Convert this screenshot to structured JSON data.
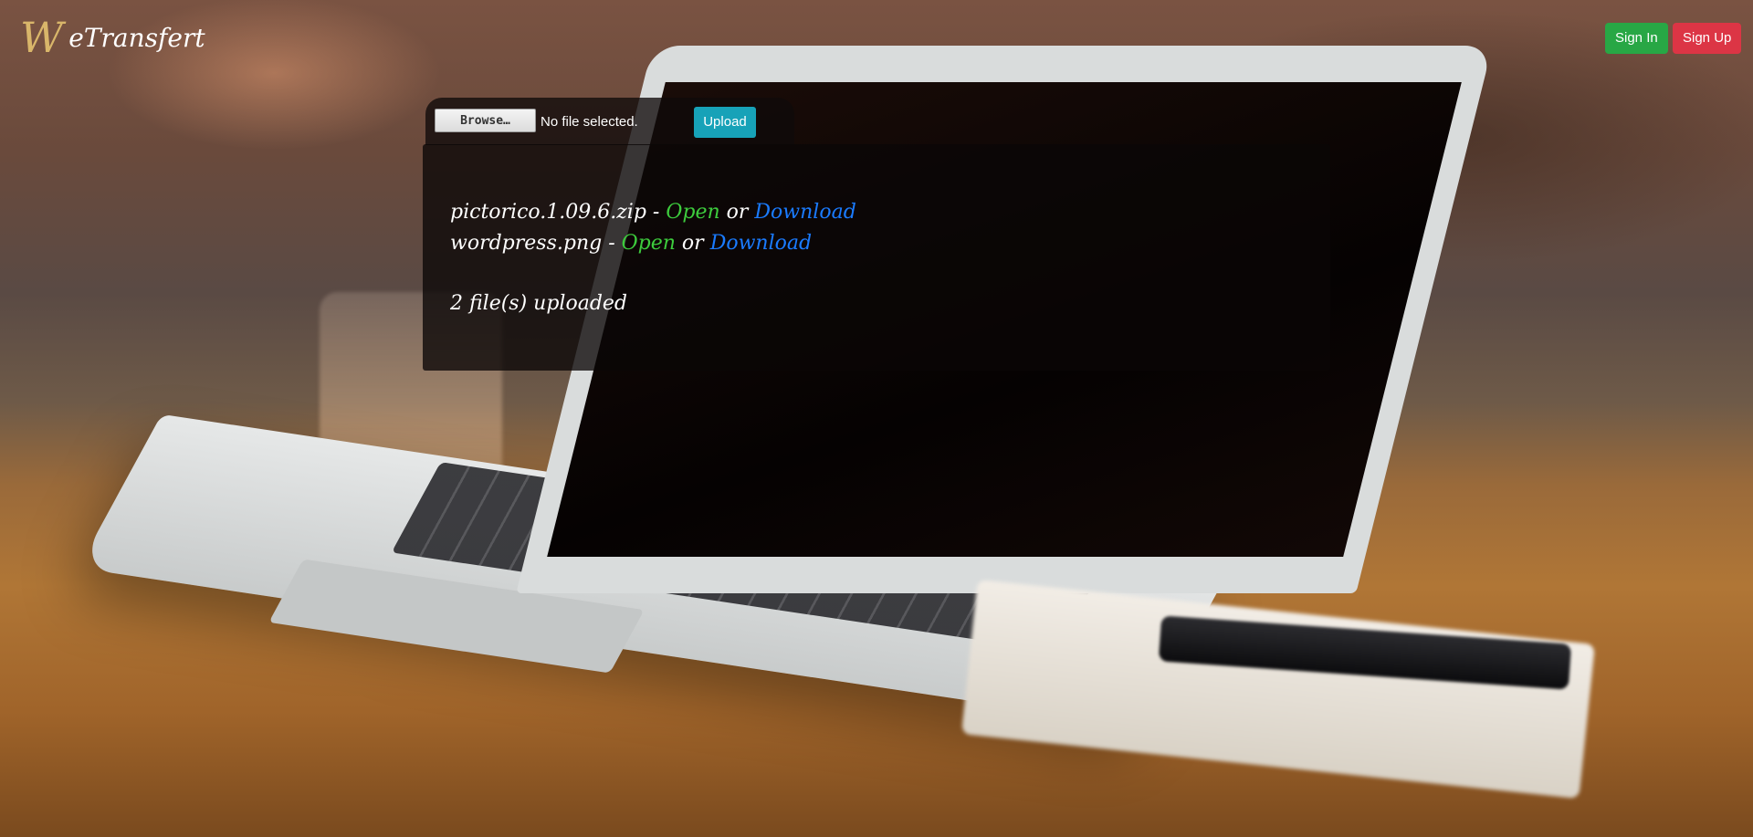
{
  "brand": {
    "logo_mark": "W",
    "name": "eTransfert"
  },
  "header": {
    "sign_in_label": "Sign In",
    "sign_up_label": "Sign Up",
    "sign_in_color": "#28a745",
    "sign_up_color": "#dc3545"
  },
  "upload": {
    "browse_label": "Browse…",
    "file_status": "No file selected.",
    "upload_label": "Upload",
    "upload_color": "#17a2b8"
  },
  "files": [
    {
      "name": "pictorico.1.09.6.zip",
      "separator": " - ",
      "open_label": "Open",
      "or_text": " or ",
      "download_label": "Download"
    },
    {
      "name": "wordpress.png",
      "separator": " - ",
      "open_label": "Open",
      "or_text": " or ",
      "download_label": "Download"
    }
  ],
  "summary": "2 file(s) uploaded",
  "colors": {
    "open_link": "#3dcc3d",
    "download_link": "#1a7bff"
  }
}
